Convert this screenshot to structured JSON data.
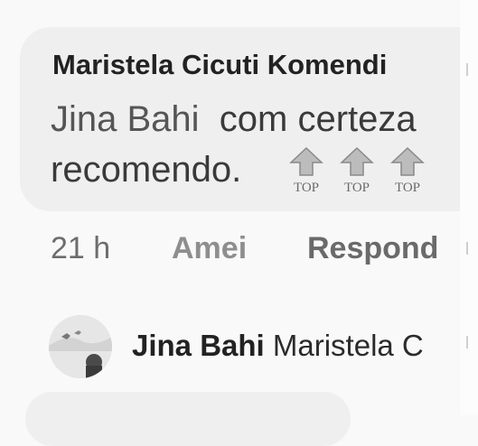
{
  "comment": {
    "author": "Maristela Cicuti Komendi",
    "mention": "Jina Bahi",
    "text_line1_rest": "com certeza",
    "text_line2": "recomendo.",
    "emoji": [
      "TOP",
      "TOP",
      "TOP"
    ],
    "emoji_icon": "top-arrow-icon",
    "time": "21 h",
    "love_label": "Amei",
    "reply_label": "Respond"
  },
  "reply": {
    "author": "Jina Bahi",
    "mention": "Maristela C",
    "avatar_icon": "avatar"
  }
}
